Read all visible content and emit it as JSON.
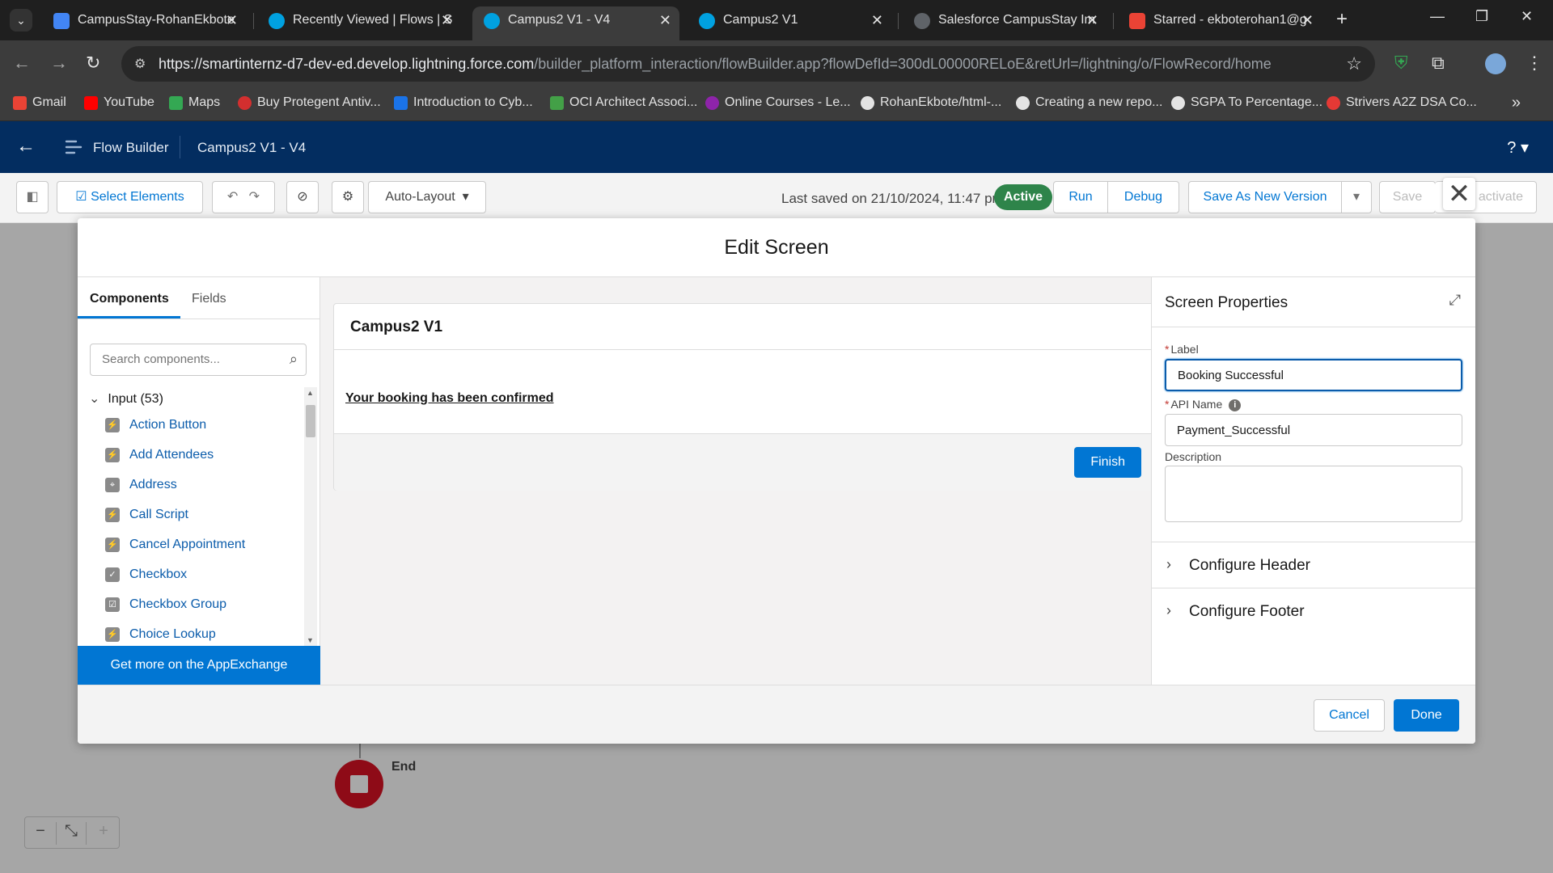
{
  "browser": {
    "tabs": [
      {
        "title": "CampusStay-RohanEkbote",
        "favicon_color": "#4285f4"
      },
      {
        "title": "Recently Viewed | Flows | S",
        "favicon_color": "#00a1e0"
      },
      {
        "title": "Campus2 V1 - V4",
        "favicon_color": "#00a1e0",
        "active": true
      },
      {
        "title": "Campus2 V1",
        "favicon_color": "#00a1e0"
      },
      {
        "title": "Salesforce CampusStay Im",
        "favicon_color": "#e3e3e3"
      },
      {
        "title": "Starred - ekboterohan1@g",
        "favicon_color": "#ea4335"
      }
    ],
    "url_host": "https://smartinternz-d7-dev-ed.develop.lightning.force.com",
    "url_path": "/builder_platform_interaction/flowBuilder.app?flowDefId=300dL00000RELoE&retUrl=/lightning/o/FlowRecord/home",
    "bookmarks": [
      {
        "label": "Gmail",
        "color": "#ea4335"
      },
      {
        "label": "YouTube",
        "color": "#ff0000"
      },
      {
        "label": "Maps",
        "color": "#34a853"
      },
      {
        "label": "Buy Protegent Antiv...",
        "color": "#d32f2f"
      },
      {
        "label": "Introduction to Cyb...",
        "color": "#1a73e8"
      },
      {
        "label": "OCI Architect Associ...",
        "color": "#43a047"
      },
      {
        "label": "Online Courses - Le...",
        "color": "#8e24aa"
      },
      {
        "label": "RohanEkbote/html-...",
        "color": "#e3e3e3"
      },
      {
        "label": "Creating a new repo...",
        "color": "#e3e3e3"
      },
      {
        "label": "SGPA To Percentage...",
        "color": "#e3e3e3"
      },
      {
        "label": "Strivers A2Z DSA Co...",
        "color": "#e53935"
      }
    ]
  },
  "sf_header": {
    "app_name": "Flow Builder",
    "flow_name": "Campus2 V1 - V4",
    "help": "?"
  },
  "toolbar": {
    "select_elements": "Select Elements",
    "layout": "Auto-Layout",
    "last_saved": "Last saved on 21/10/2024, 11:47 pm",
    "status": "Active",
    "run": "Run",
    "debug": "Debug",
    "save_as_new": "Save As New Version",
    "save": "Save",
    "deactivate_partial": "activate"
  },
  "canvas": {
    "end_label": "End"
  },
  "modal": {
    "title": "Edit Screen",
    "left": {
      "tab_components": "Components",
      "tab_fields": "Fields",
      "search_placeholder": "Search components...",
      "group_label": "Input (53)",
      "items": [
        {
          "label": "Action Button",
          "icon": "bolt-icon",
          "glyph": "⚡"
        },
        {
          "label": "Add Attendees",
          "icon": "bolt-icon",
          "glyph": "⚡"
        },
        {
          "label": "Address",
          "icon": "location-icon",
          "glyph": "⌖"
        },
        {
          "label": "Call Script",
          "icon": "bolt-icon",
          "glyph": "⚡"
        },
        {
          "label": "Cancel Appointment",
          "icon": "bolt-icon",
          "glyph": "⚡"
        },
        {
          "label": "Checkbox",
          "icon": "checkbox-icon",
          "glyph": "✓"
        },
        {
          "label": "Checkbox Group",
          "icon": "checkbox-group-icon",
          "glyph": "☑"
        },
        {
          "label": "Choice Lookup",
          "icon": "bolt-icon",
          "glyph": "⚡"
        }
      ],
      "appexchange": "Get more on the AppExchange"
    },
    "preview": {
      "title": "Campus2 V1",
      "text": "Your booking has been confirmed",
      "finish": "Finish"
    },
    "properties": {
      "title": "Screen Properties",
      "label_label": "Label",
      "label_value": "Booking Successful",
      "api_label": "API Name",
      "api_value": "Payment_Successful",
      "description_label": "Description",
      "configure_header": "Configure Header",
      "configure_footer": "Configure Footer"
    },
    "footer": {
      "cancel": "Cancel",
      "done": "Done"
    }
  }
}
